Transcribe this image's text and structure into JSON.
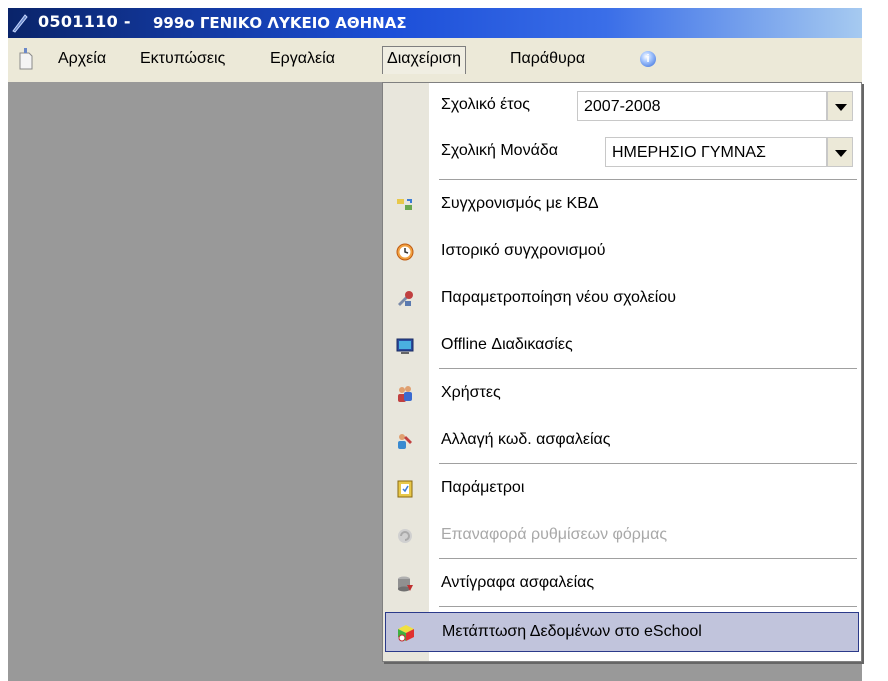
{
  "window": {
    "code": "0501110 -",
    "school": "999o ΓΕΝΙΚΟ ΛΥΚΕΙΟ ΑΘΗΝΑΣ"
  },
  "menubar": {
    "items": [
      {
        "label": "Αρχεία"
      },
      {
        "label": "Εκτυπώσεις"
      },
      {
        "label": "Εργαλεία"
      },
      {
        "label": "Διαχείριση"
      },
      {
        "label": "Παράθυρα"
      }
    ],
    "info_icon": "i"
  },
  "dropdown": {
    "school_year": {
      "label": "Σχολικό έτος",
      "value": "2007-2008"
    },
    "school_unit": {
      "label": "Σχολική Μονάδα",
      "value": "ΗΜΕΡΗΣΙΟ ΓΥΜΝΑΣ"
    },
    "items": [
      {
        "label": "Συγχρονισμός με ΚΒΔ",
        "icon": "sync-icon"
      },
      {
        "label": "Ιστορικό συγχρονισμού",
        "icon": "clock-icon"
      },
      {
        "label": "Παραμετροποίηση νέου σχολείου",
        "icon": "tools-icon"
      },
      {
        "label": "Offline Διαδικασίες",
        "icon": "monitor-icon"
      },
      {
        "label": "Χρήστες",
        "icon": "users-icon"
      },
      {
        "label": "Αλλαγή κωδ. ασφαλείας",
        "icon": "user-key-icon"
      },
      {
        "label": "Παράμετροι",
        "icon": "parameters-icon"
      },
      {
        "label": "Επαναφορά ρυθμίσεων φόρμας",
        "icon": "reset-icon",
        "disabled": true
      },
      {
        "label": "Αντίγραφα ασφαλείας",
        "icon": "database-icon"
      },
      {
        "label": "Μετάπτωση Δεδομένων στο eSchool",
        "icon": "cube-icon",
        "highlighted": true
      }
    ]
  },
  "colors": {
    "titlebar": "#0a246a",
    "menubar": "#ece9d8",
    "workspace": "#999999",
    "highlight": "#c1c4dc"
  }
}
